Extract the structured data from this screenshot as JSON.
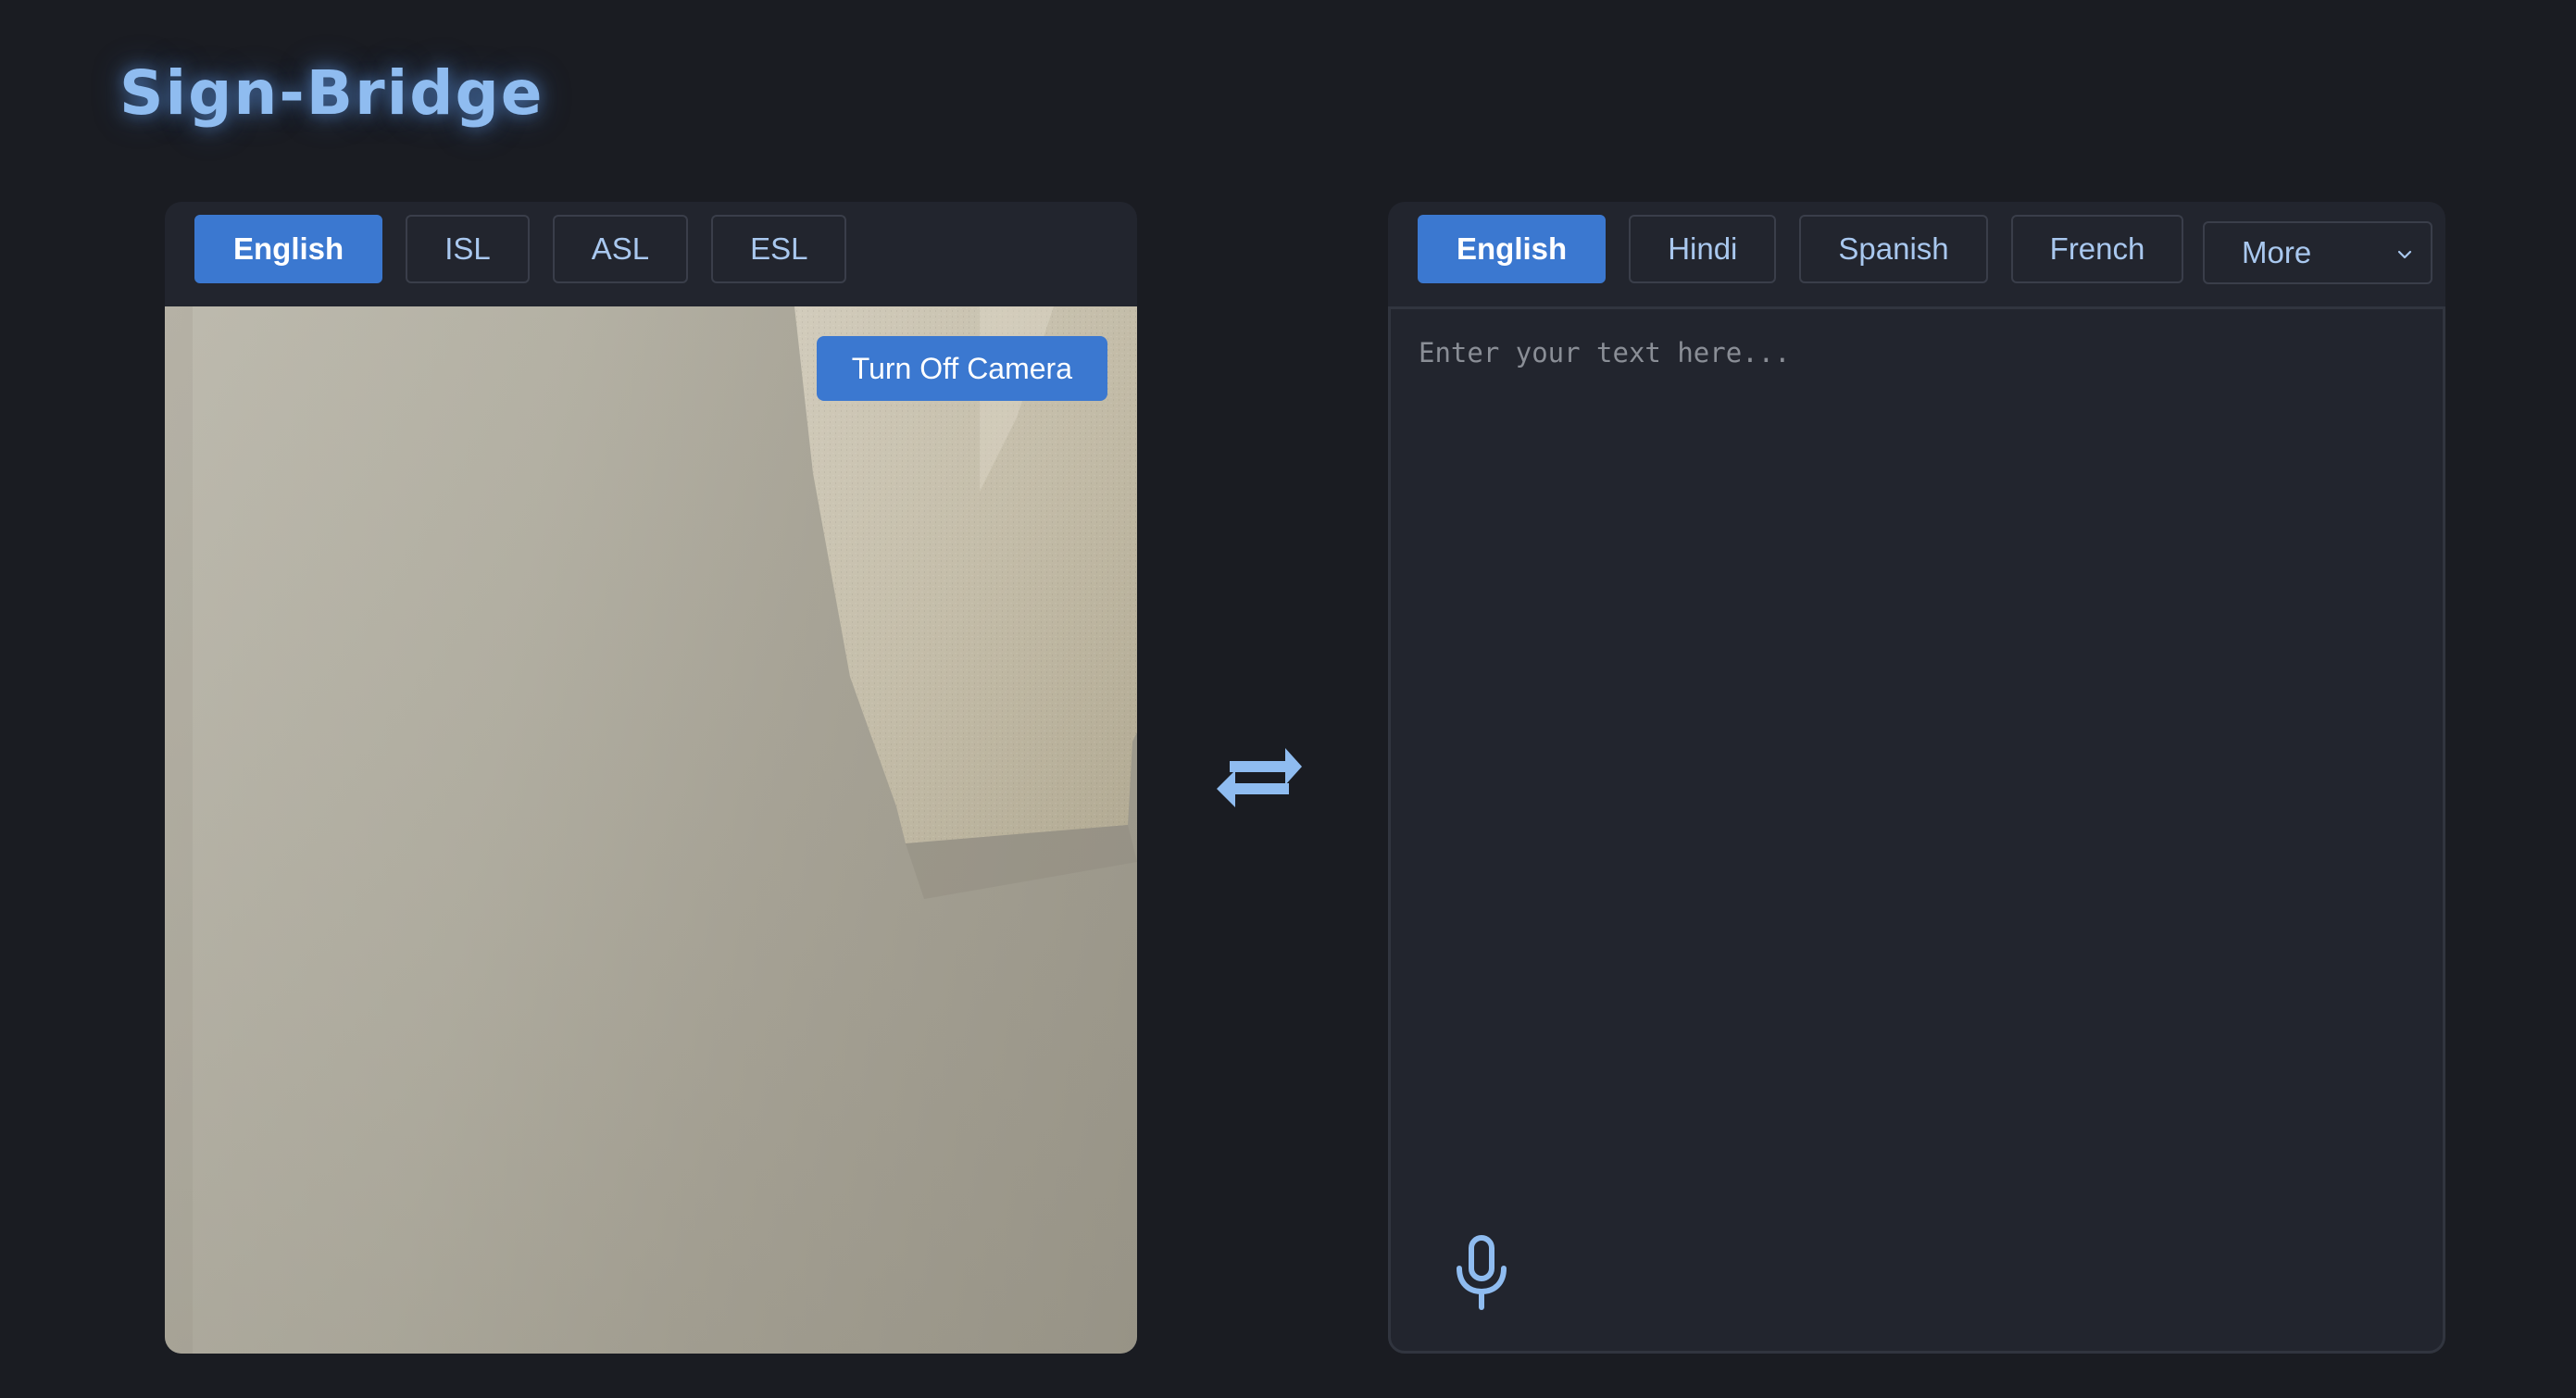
{
  "app": {
    "title": "Sign-Bridge"
  },
  "source_panel": {
    "tabs": [
      {
        "label": "English",
        "active": true
      },
      {
        "label": "ISL",
        "active": false
      },
      {
        "label": "ASL",
        "active": false
      },
      {
        "label": "ESL",
        "active": false
      }
    ],
    "camera_button_label": "Turn Off Camera"
  },
  "swap": {
    "icon": "swap-arrows-icon"
  },
  "target_panel": {
    "tabs": [
      {
        "label": "English",
        "active": true
      },
      {
        "label": "Hindi",
        "active": false
      },
      {
        "label": "Spanish",
        "active": false
      },
      {
        "label": "French",
        "active": false
      }
    ],
    "more_select": {
      "selected": "More"
    },
    "text_input": {
      "value": "",
      "placeholder": "Enter your text here..."
    },
    "mic_icon": "microphone-icon"
  },
  "colors": {
    "background": "#1a1c22",
    "panel": "#22252e",
    "accent": "#3b78d0",
    "title": "#8fbcf0",
    "tab_text": "#a9c8ef"
  }
}
